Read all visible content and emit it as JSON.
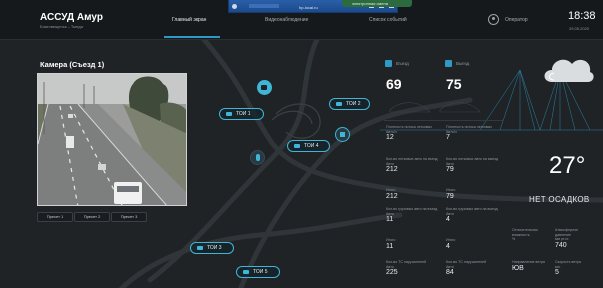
{
  "header": {
    "title": "АССУД Амур",
    "subtitle": "Благовещенск – Тында",
    "nav": [
      {
        "label": "Главный экран",
        "active": true
      },
      {
        "label": "Видеонаблюдение",
        "active": false
      },
      {
        "label": "Список событий",
        "active": false
      }
    ],
    "user_label": "Оператор",
    "time": "18:38",
    "date": "29.05.2020",
    "browser_bar_text": "hp-local.ru",
    "green_pill_text": "электронная смена"
  },
  "camera": {
    "title": "Камера  (Съезд 1)",
    "presets": [
      "Пресет 1",
      "Пресет 2",
      "Пресет 3"
    ]
  },
  "map": {
    "chips": [
      "ТОИ 1",
      "ТОИ 2",
      "ТОИ 4",
      "ТОИ 3",
      "ТОИ 5"
    ]
  },
  "stats": {
    "dir1": {
      "label": "Въезд",
      "count": "69"
    },
    "dir2": {
      "label": "Выезд",
      "count": "75"
    },
    "col1": [
      {
        "label": "Плотность потока легковых",
        "sub": "Авто/ч",
        "value": "12"
      },
      {
        "label": "Кол-во легковых авто на въезд",
        "sub": "Авто",
        "value": "212"
      },
      {
        "label": "Итого",
        "sub": "",
        "value": "212"
      },
      {
        "label": "Кол-во грузовых авто на въезд",
        "sub": "Авто",
        "value": "11"
      },
      {
        "label": "Итого",
        "sub": "",
        "value": "11"
      },
      {
        "label": "Кол-во ТС нарушителей",
        "sub": "Авто",
        "value": "225"
      }
    ],
    "col2": [
      {
        "label": "Плотность потока легковых",
        "sub": "Авто/ч",
        "value": "7"
      },
      {
        "label": "Кол-во легковых авто на выезд",
        "sub": "Авто",
        "value": "79"
      },
      {
        "label": "Итого",
        "sub": "",
        "value": "79"
      },
      {
        "label": "Кол-во грузовых авто на выезд",
        "sub": "Авто",
        "value": "4"
      },
      {
        "label": "Итого",
        "sub": "",
        "value": "4"
      },
      {
        "label": "Кол-во ТС нарушителей",
        "sub": "Авто",
        "value": "84"
      }
    ],
    "col3": [
      {
        "label": "Относительная влажность",
        "sub": "%",
        "value": "—"
      },
      {
        "label": "Направление ветра",
        "sub": "",
        "value": "ЮВ"
      }
    ],
    "col4": [
      {
        "label": "Атмосферное давление",
        "sub": "мм рт.ст.",
        "value": "740"
      },
      {
        "label": "Скорость ветра",
        "sub": "м/с",
        "value": "5"
      }
    ]
  },
  "weather": {
    "temperature": "27°",
    "condition": "НЕТ ОСАДКОВ",
    "icon": "cloud-icon"
  },
  "colors": {
    "accent": "#2e98c7",
    "background": "#1f2326",
    "header": "#16191b"
  }
}
